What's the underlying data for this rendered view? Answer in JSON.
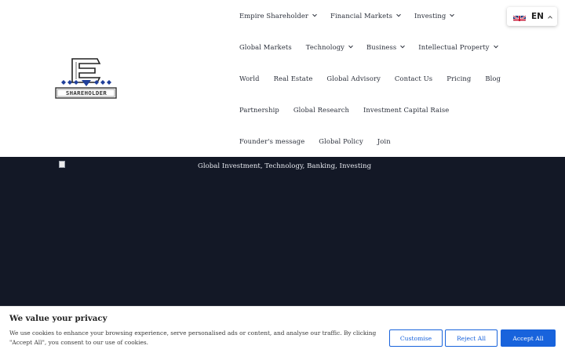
{
  "logo": {
    "text": "SHAREHOLDER",
    "alt": "Empire Shareholder logo",
    "icon": "empire-e-logo"
  },
  "nav": {
    "rows": [
      [
        {
          "label": "Empire Shareholder",
          "dropdown": true
        },
        {
          "label": "Financial Markets",
          "dropdown": true
        },
        {
          "label": "Investing",
          "dropdown": true
        }
      ],
      [
        {
          "label": "Global Markets",
          "dropdown": false
        },
        {
          "label": "Technology",
          "dropdown": true
        },
        {
          "label": "Business",
          "dropdown": true
        },
        {
          "label": "Intellectual Property",
          "dropdown": true
        }
      ],
      [
        {
          "label": "World",
          "dropdown": false
        },
        {
          "label": "Real Estate",
          "dropdown": false
        },
        {
          "label": "Global Advisory",
          "dropdown": false
        },
        {
          "label": "Contact Us",
          "dropdown": false
        },
        {
          "label": "Pricing",
          "dropdown": false
        },
        {
          "label": "Blog",
          "dropdown": false
        }
      ],
      [
        {
          "label": "Partnership",
          "dropdown": false
        },
        {
          "label": "Global Research",
          "dropdown": false
        },
        {
          "label": "Investment Capital Raise",
          "dropdown": false
        }
      ],
      [
        {
          "label": "Founder's message",
          "dropdown": false
        },
        {
          "label": "Global Policy",
          "dropdown": false
        },
        {
          "label": "Join",
          "dropdown": false
        }
      ]
    ]
  },
  "language": {
    "code": "EN",
    "flag": "uk-flag-icon"
  },
  "hero": {
    "caption": "Global Investment, Technology, Banking, Investing"
  },
  "cookie": {
    "title": "We value your privacy",
    "text": "We use cookies to enhance your browsing experience, serve personalised ads or content, and analyse our traffic. By clicking \"Accept All\", you consent to our use of cookies.",
    "customise": "Customise",
    "reject": "Reject All",
    "accept": "Accept All"
  },
  "colors": {
    "hero_bg": "#131826",
    "accent": "#1863dc",
    "nav_text": "#2a2f3a"
  }
}
